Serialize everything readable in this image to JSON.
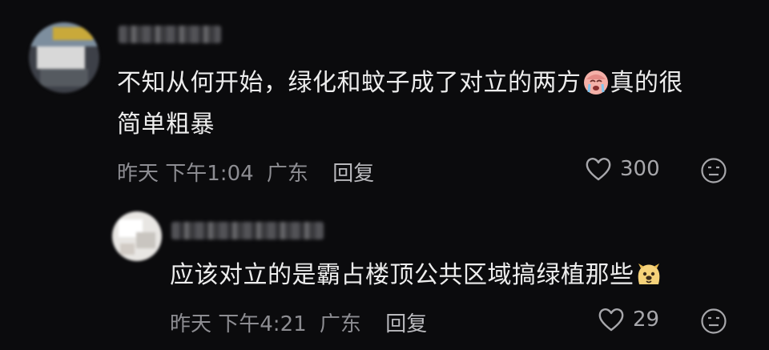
{
  "comments": [
    {
      "text_line1": "不知从何开始，绿化和蚊子成了对立的两方",
      "emoji": "crying-face-emoji",
      "text_line1_tail": "真的很",
      "text_line2": "简单粗暴",
      "time": "昨天 下午1:04",
      "location": "广东",
      "reply_label": "回复",
      "likes": "300",
      "like_icon": "heart-icon",
      "react_icon": "neutral-face-icon"
    },
    {
      "text_line1": "应该对立的是霸占楼顶公共区域搞绿植那些",
      "emoji": "dog-face-emoji",
      "time": "昨天 下午4:21",
      "location": "广东",
      "reply_label": "回复",
      "likes": "29",
      "like_icon": "heart-icon",
      "react_icon": "neutral-face-icon"
    }
  ],
  "colors": {
    "background": "#0b0b0d",
    "text": "#ededed",
    "meta": "#8d8d92"
  }
}
